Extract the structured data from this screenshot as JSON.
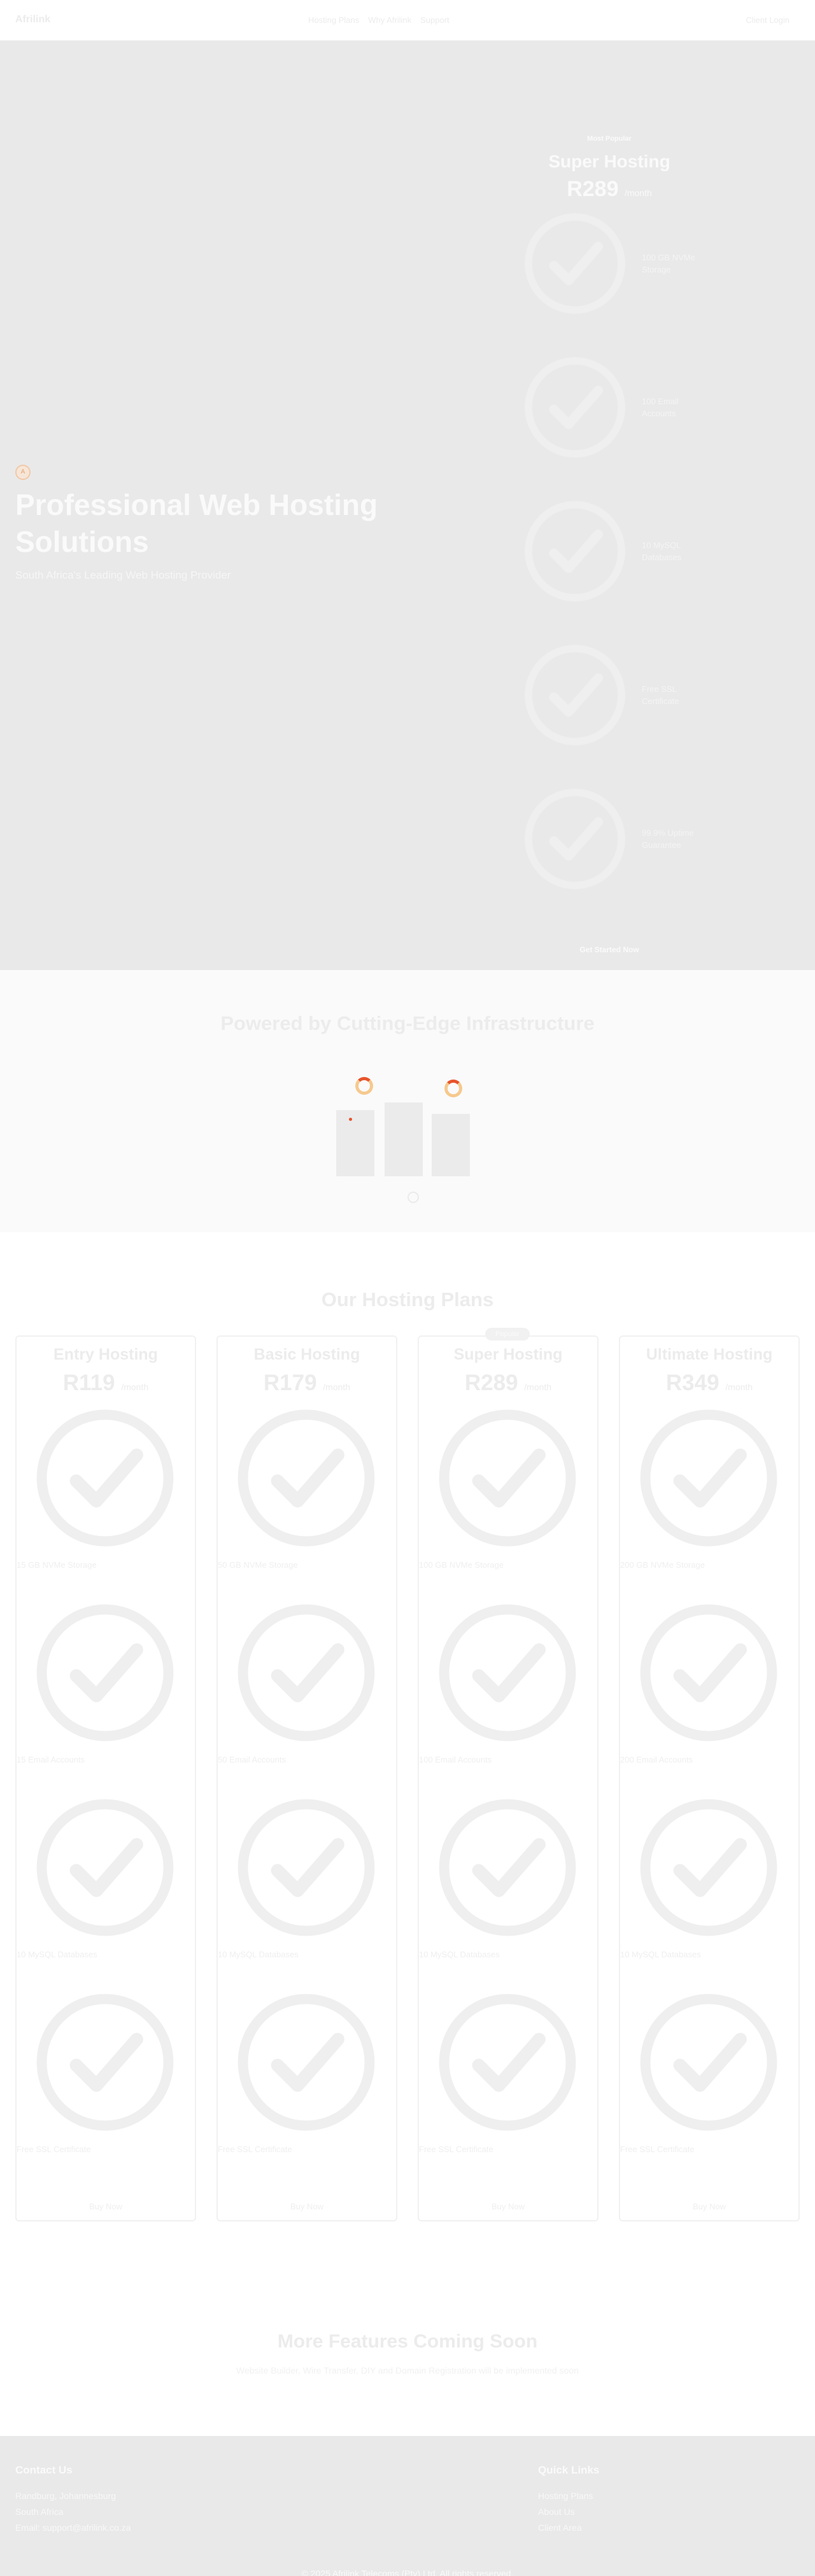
{
  "nav": {
    "brand": "Afrilink",
    "links": [
      "Hosting Plans",
      "Why Afrilink",
      "Support"
    ],
    "login": "Client Login"
  },
  "hero": {
    "title": "Professional Web Hosting Solutions",
    "subtitle": "South Africa's Leading Web Hosting Provider"
  },
  "promo": {
    "badge": "Most Popular",
    "plan_name": "Super Hosting",
    "price": "R289",
    "per": "/month",
    "features": [
      "100 GB NVMe Storage",
      "100 Email Accounts",
      "10 MySQL Databases",
      "Free SSL Certificate",
      "99.9% Uptime Guarantee"
    ],
    "cta": "Get Started Now"
  },
  "infra": {
    "title": "Powered by Cutting-Edge Infrastructure"
  },
  "plans": {
    "title": "Our Hosting Plans",
    "popular_badge": "Popular",
    "cards": [
      {
        "name": "Entry Hosting",
        "price": "R119",
        "per": "/month",
        "features": [
          "15 GB NVMe Storage",
          "15 Email Accounts",
          "10 MySQL Databases",
          "Free SSL Certificate"
        ],
        "buy": "Buy Now"
      },
      {
        "name": "Basic Hosting",
        "price": "R179",
        "per": "/month",
        "features": [
          "50 GB NVMe Storage",
          "50 Email Accounts",
          "10 MySQL Databases",
          "Free SSL Certificate"
        ],
        "buy": "Buy Now"
      },
      {
        "name": "Super Hosting",
        "price": "R289",
        "per": "/month",
        "features": [
          "100 GB NVMe Storage",
          "100 Email Accounts",
          "10 MySQL Databases",
          "Free SSL Certificate"
        ],
        "buy": "Buy Now"
      },
      {
        "name": "Ultimate Hosting",
        "price": "R349",
        "per": "/month",
        "features": [
          "200 GB NVMe Storage",
          "200 Email Accounts",
          "10 MySQL Databases",
          "Free SSL Certificate"
        ],
        "buy": "Buy Now"
      }
    ]
  },
  "soon": {
    "title": "More Features Coming Soon",
    "text": "Website Builder, Wire Transfer, DIY and Domain Registration will be implemented soon"
  },
  "footer": {
    "contact_title": "Contact Us",
    "contact_lines": [
      "Randburg, Johannesburg",
      "South Africa",
      "Email: support@afrilink.co.za"
    ],
    "links_title": "Quick Links",
    "links": [
      "Hosting Plans",
      "About Us",
      "Client Area"
    ],
    "copyright": "© 2025 Afrilink Telecoms (Pty) Ltd. All rights reserved."
  },
  "icons": {
    "check": "check-circle-icon",
    "spinner": "loading-spinner-icon",
    "logo_mark": "afrilink-mark"
  },
  "colors": {
    "hero_bg": "#e9e9e9",
    "accent": "#e8542b",
    "spinner_ring": "#f6c98e"
  }
}
